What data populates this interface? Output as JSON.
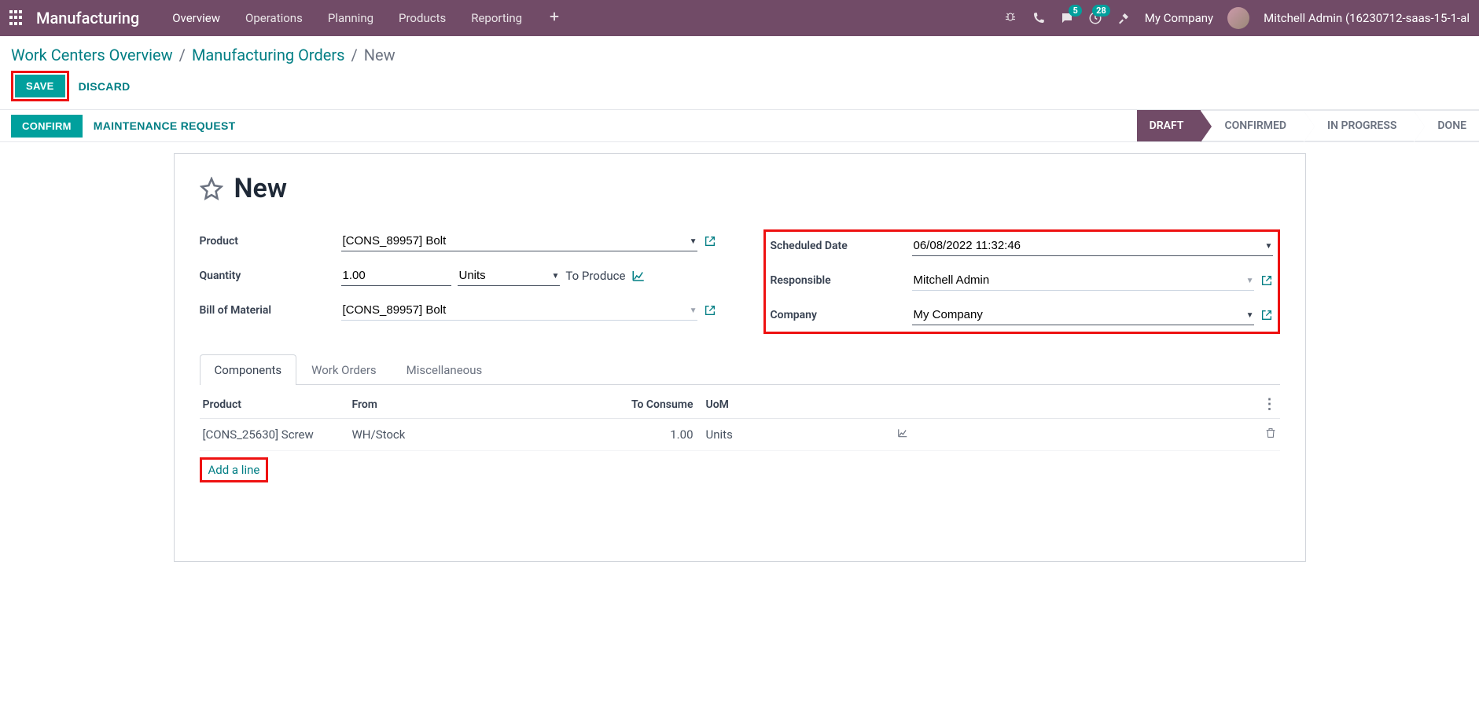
{
  "nav": {
    "app": "Manufacturing",
    "items": [
      "Overview",
      "Operations",
      "Planning",
      "Products",
      "Reporting"
    ],
    "msg_badge": "5",
    "activity_badge": "28",
    "company": "My Company",
    "user": "Mitchell Admin (16230712-saas-15-1-al"
  },
  "breadcrumb": {
    "root": "Work Centers Overview",
    "parent": "Manufacturing Orders",
    "current": "New"
  },
  "buttons": {
    "save": "SAVE",
    "discard": "DISCARD",
    "confirm": "CONFIRM",
    "maintenance": "MAINTENANCE REQUEST"
  },
  "status": {
    "steps": [
      "DRAFT",
      "CONFIRMED",
      "IN PROGRESS",
      "DONE"
    ]
  },
  "form": {
    "title": "New",
    "labels": {
      "product": "Product",
      "quantity": "Quantity",
      "bom": "Bill of Material",
      "scheduled": "Scheduled Date",
      "responsible": "Responsible",
      "company": "Company",
      "to_produce": "To Produce"
    },
    "values": {
      "product": "[CONS_89957] Bolt",
      "quantity": "1.00",
      "quantity_uom": "Units",
      "bom": "[CONS_89957] Bolt",
      "scheduled": "06/08/2022 11:32:46",
      "responsible": "Mitchell Admin",
      "company": "My Company"
    }
  },
  "tabs": [
    "Components",
    "Work Orders",
    "Miscellaneous"
  ],
  "components": {
    "headers": {
      "product": "Product",
      "from": "From",
      "consume": "To Consume",
      "uom": "UoM"
    },
    "rows": [
      {
        "product": "[CONS_25630] Screw",
        "from": "WH/Stock",
        "consume": "1.00",
        "uom": "Units"
      }
    ],
    "add": "Add a line"
  }
}
